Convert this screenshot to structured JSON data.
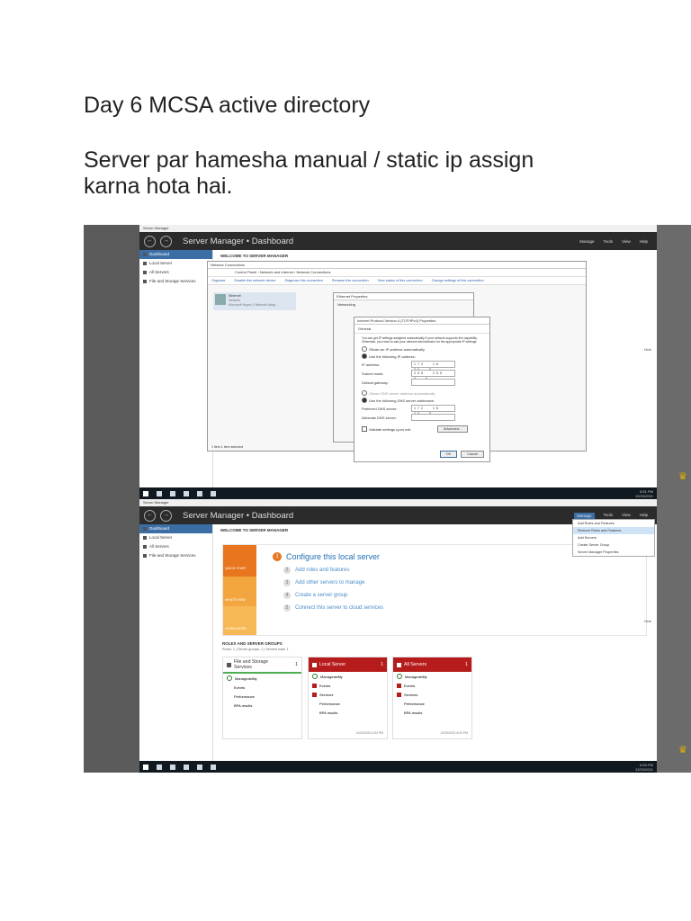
{
  "doc": {
    "title": "Day 6 MCSA active directory",
    "note": "Server par hamesha manual / static ip assign karna hota hai."
  },
  "shot1": {
    "window_title": "Server Manager",
    "header": {
      "back": "←",
      "forward": "→",
      "title": "Server Manager • Dashboard",
      "menus": [
        "Manage",
        "Tools",
        "View",
        "Help"
      ]
    },
    "sidebar": [
      "Dashboard",
      "Local Server",
      "All Servers",
      "File and Storage Services"
    ],
    "welcome": "WELCOME TO SERVER MANAGER",
    "netconn": {
      "title": "Network Connections",
      "address": "Control Panel › Network and Internet › Network Connections",
      "toolbar": [
        "Organize",
        "Disable this network device",
        "Diagnose this connection",
        "Rename this connection",
        "View status of this connection",
        "Change settings of this connection"
      ],
      "adapter_name": "Ethernet",
      "adapter_net": "Network",
      "adapter_desc": "Microsoft Hyper-V Network Adap...",
      "status": "1 item    1 item selected"
    },
    "eth_props": {
      "title": "Ethernet Properties",
      "tab": "Networking"
    },
    "ipv4": {
      "title": "Internet Protocol Version 4 (TCP/IPv4) Properties",
      "tab": "General",
      "desc": "You can get IP settings assigned automatically if your network supports this capability. Otherwise, you need to ask your network administrator for the appropriate IP settings.",
      "opt_auto": "Obtain an IP address automatically",
      "opt_manual": "Use the following IP address:",
      "ip_label": "IP address:",
      "ip": "172 . 16 . 20 . 5",
      "mask_label": "Subnet mask:",
      "mask": "255 . 255 . 0 . 0",
      "gw_label": "Default gateway:",
      "gw": "",
      "dns_auto": "Obtain DNS server address automatically",
      "dns_manual": "Use the following DNS server addresses:",
      "pdns_label": "Preferred DNS server:",
      "pdns": "172 . 16 . 20 . 5",
      "adns_label": "Alternate DNS server:",
      "adns": "",
      "validate": "Validate settings upon exit",
      "advanced": "Advanced...",
      "ok": "OK",
      "cancel": "Cancel"
    },
    "hide": "Hide",
    "clock": {
      "time": "6:51 PM",
      "date": "12/20/2021"
    }
  },
  "shot2": {
    "window_title": "Server Manager",
    "header": {
      "back": "←",
      "forward": "→",
      "title": "Server Manager • Dashboard",
      "menus": [
        "Manage",
        "Tools",
        "View",
        "Help"
      ]
    },
    "sidebar": [
      "Dashboard",
      "Local Server",
      "All Servers",
      "File and Storage Services"
    ],
    "welcome": "WELCOME TO SERVER MANAGER",
    "bands": [
      "QUICK START",
      "WHAT'S NEW",
      "LEARN MORE"
    ],
    "step1": "Configure this local server",
    "steps": [
      "Add roles and features",
      "Add other servers to manage",
      "Create a server group",
      "Connect this server to cloud services"
    ],
    "hide": "Hide",
    "roles_heading": "ROLES AND SERVER GROUPS",
    "roles_sub": "Roles: 1  |  Server groups: 1  |  Servers total: 1",
    "tiles": [
      {
        "title": "File and Storage Services",
        "count": "1",
        "rows": [
          "Manageability",
          "Events",
          "Performance",
          "BPA results"
        ],
        "stamp": ""
      },
      {
        "title": "Local Server",
        "count": "1",
        "rows": [
          "Manageability",
          "Events",
          "Services",
          "Performance",
          "BPA results"
        ],
        "stamp": "12/20/2021 6:52 PM"
      },
      {
        "title": "All Servers",
        "count": "1",
        "rows": [
          "Manageability",
          "Events",
          "Services",
          "Performance",
          "BPA results"
        ],
        "stamp": "12/20/2021 6:52 PM"
      }
    ],
    "manage_menu": [
      "Add Roles and Features",
      "Remove Roles and Features",
      "Add Servers",
      "Create Server Group",
      "Server Manager Properties"
    ],
    "clock": {
      "time": "6:53 PM",
      "date": "12/20/2021"
    }
  }
}
